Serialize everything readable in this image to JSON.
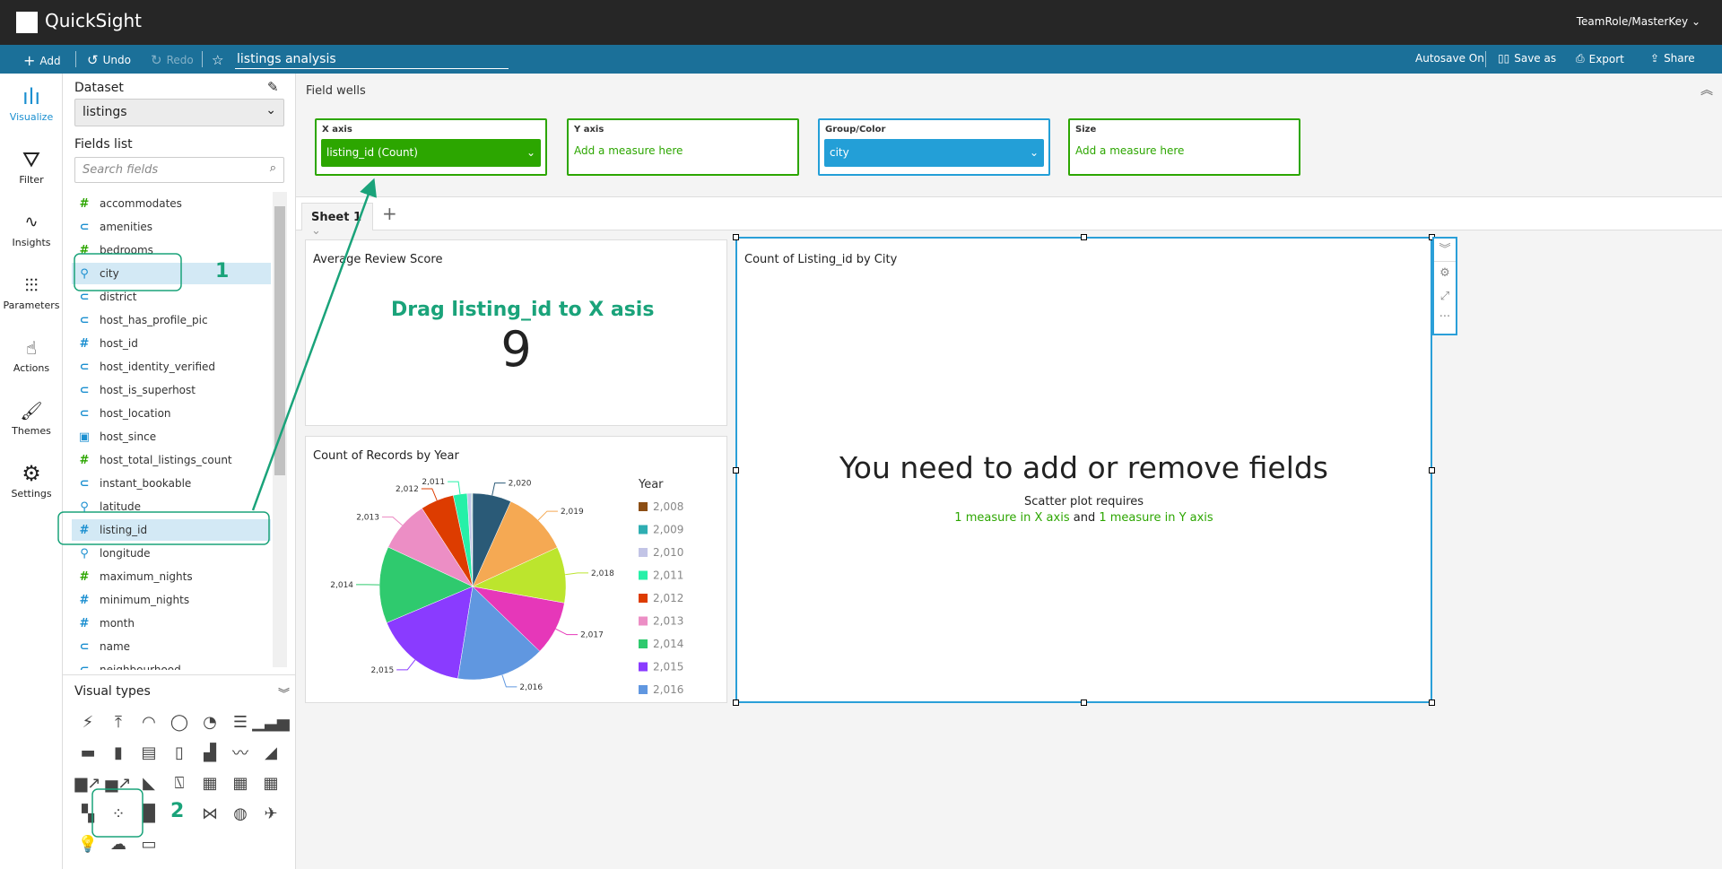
{
  "topbar": {
    "brand": "QuickSight",
    "user": "TeamRole/MasterKey"
  },
  "toolbar": {
    "add": "Add",
    "undo": "Undo",
    "redo": "Redo",
    "analysis_title": "listings analysis",
    "autosave": "Autosave On",
    "save_as": "Save as",
    "export": "Export",
    "share": "Share"
  },
  "rail": [
    {
      "label": "Visualize",
      "icon": "bar-chart-icon"
    },
    {
      "label": "Filter",
      "icon": "filter-icon"
    },
    {
      "label": "Insights",
      "icon": "insights-icon"
    },
    {
      "label": "Parameters",
      "icon": "sliders-icon"
    },
    {
      "label": "Actions",
      "icon": "pointer-gear-icon"
    },
    {
      "label": "Themes",
      "icon": "brush-icon"
    },
    {
      "label": "Settings",
      "icon": "gear-icon"
    }
  ],
  "panel": {
    "dataset_label": "Dataset",
    "dataset": "listings",
    "fields_label": "Fields list",
    "search_placeholder": "Search fields",
    "fields": [
      {
        "name": "accommodates",
        "type": "measure"
      },
      {
        "name": "amenities",
        "type": "dimension"
      },
      {
        "name": "bedrooms",
        "type": "measure"
      },
      {
        "name": "city",
        "type": "geo",
        "selected": true
      },
      {
        "name": "district",
        "type": "dimension"
      },
      {
        "name": "host_has_profile_pic",
        "type": "dimension"
      },
      {
        "name": "host_id",
        "type": "number-dimension"
      },
      {
        "name": "host_identity_verified",
        "type": "dimension"
      },
      {
        "name": "host_is_superhost",
        "type": "dimension"
      },
      {
        "name": "host_location",
        "type": "dimension"
      },
      {
        "name": "host_since",
        "type": "date"
      },
      {
        "name": "host_total_listings_count",
        "type": "measure"
      },
      {
        "name": "instant_bookable",
        "type": "dimension"
      },
      {
        "name": "latitude",
        "type": "geo"
      },
      {
        "name": "listing_id",
        "type": "number-dimension",
        "selected": true
      },
      {
        "name": "longitude",
        "type": "geo"
      },
      {
        "name": "maximum_nights",
        "type": "measure"
      },
      {
        "name": "minimum_nights",
        "type": "number-dimension"
      },
      {
        "name": "month",
        "type": "number-dimension"
      },
      {
        "name": "name",
        "type": "dimension"
      },
      {
        "name": "neighbourhood",
        "type": "dimension"
      }
    ]
  },
  "visual_types": {
    "label": "Visual types",
    "selected": "scatter-plot"
  },
  "wells": {
    "title": "Field wells",
    "x_label": "X axis",
    "x_value": "listing_id (Count)",
    "y_label": "Y axis",
    "y_placeholder": "Add a measure here",
    "group_label": "Group/Color",
    "group_value": "city",
    "size_label": "Size",
    "size_placeholder": "Add a measure here"
  },
  "sheet": {
    "tab": "Sheet 1"
  },
  "kpi": {
    "title": "Average Review Score",
    "value": "9"
  },
  "scatter": {
    "title": "Count of Listing_id by City",
    "message": "You need to add or remove fields",
    "requires": "Scatter plot requires",
    "req_x": "1 measure in X axis",
    "and": "and",
    "req_y": "1 measure in Y axis"
  },
  "annotations": {
    "step1": "1",
    "step2": "2",
    "note": "Drag listing_id to X asis",
    "color": "#1aa37a"
  },
  "colors": {
    "toolbar": "#1b7099",
    "well_green": "#2ca600",
    "group_blue": "#239fd7",
    "selection": "#2a9fd8"
  },
  "chart_data": {
    "type": "pie",
    "title": "Count of Records by Year",
    "legend_title": "Year",
    "legend_position": "right",
    "categories": [
      "2,008",
      "2,009",
      "2,010",
      "2,011",
      "2,012",
      "2,013",
      "2,014",
      "2,015",
      "2,016",
      "2,017",
      "2,018",
      "2,019",
      "2,020"
    ],
    "values": [
      0.1,
      0.15,
      0.7,
      2.4,
      5.8,
      8.9,
      13.3,
      16.1,
      15.3,
      9.4,
      9.7,
      11.4,
      6.7
    ],
    "colors": [
      "#8c4e14",
      "#2eaeb2",
      "#c2c4e6",
      "#26f0a8",
      "#dd3c00",
      "#ec8ec5",
      "#2fca6e",
      "#8a3bff",
      "#6097e0",
      "#e637b9",
      "#bce52d",
      "#f5a953",
      "#2a5a77"
    ]
  }
}
